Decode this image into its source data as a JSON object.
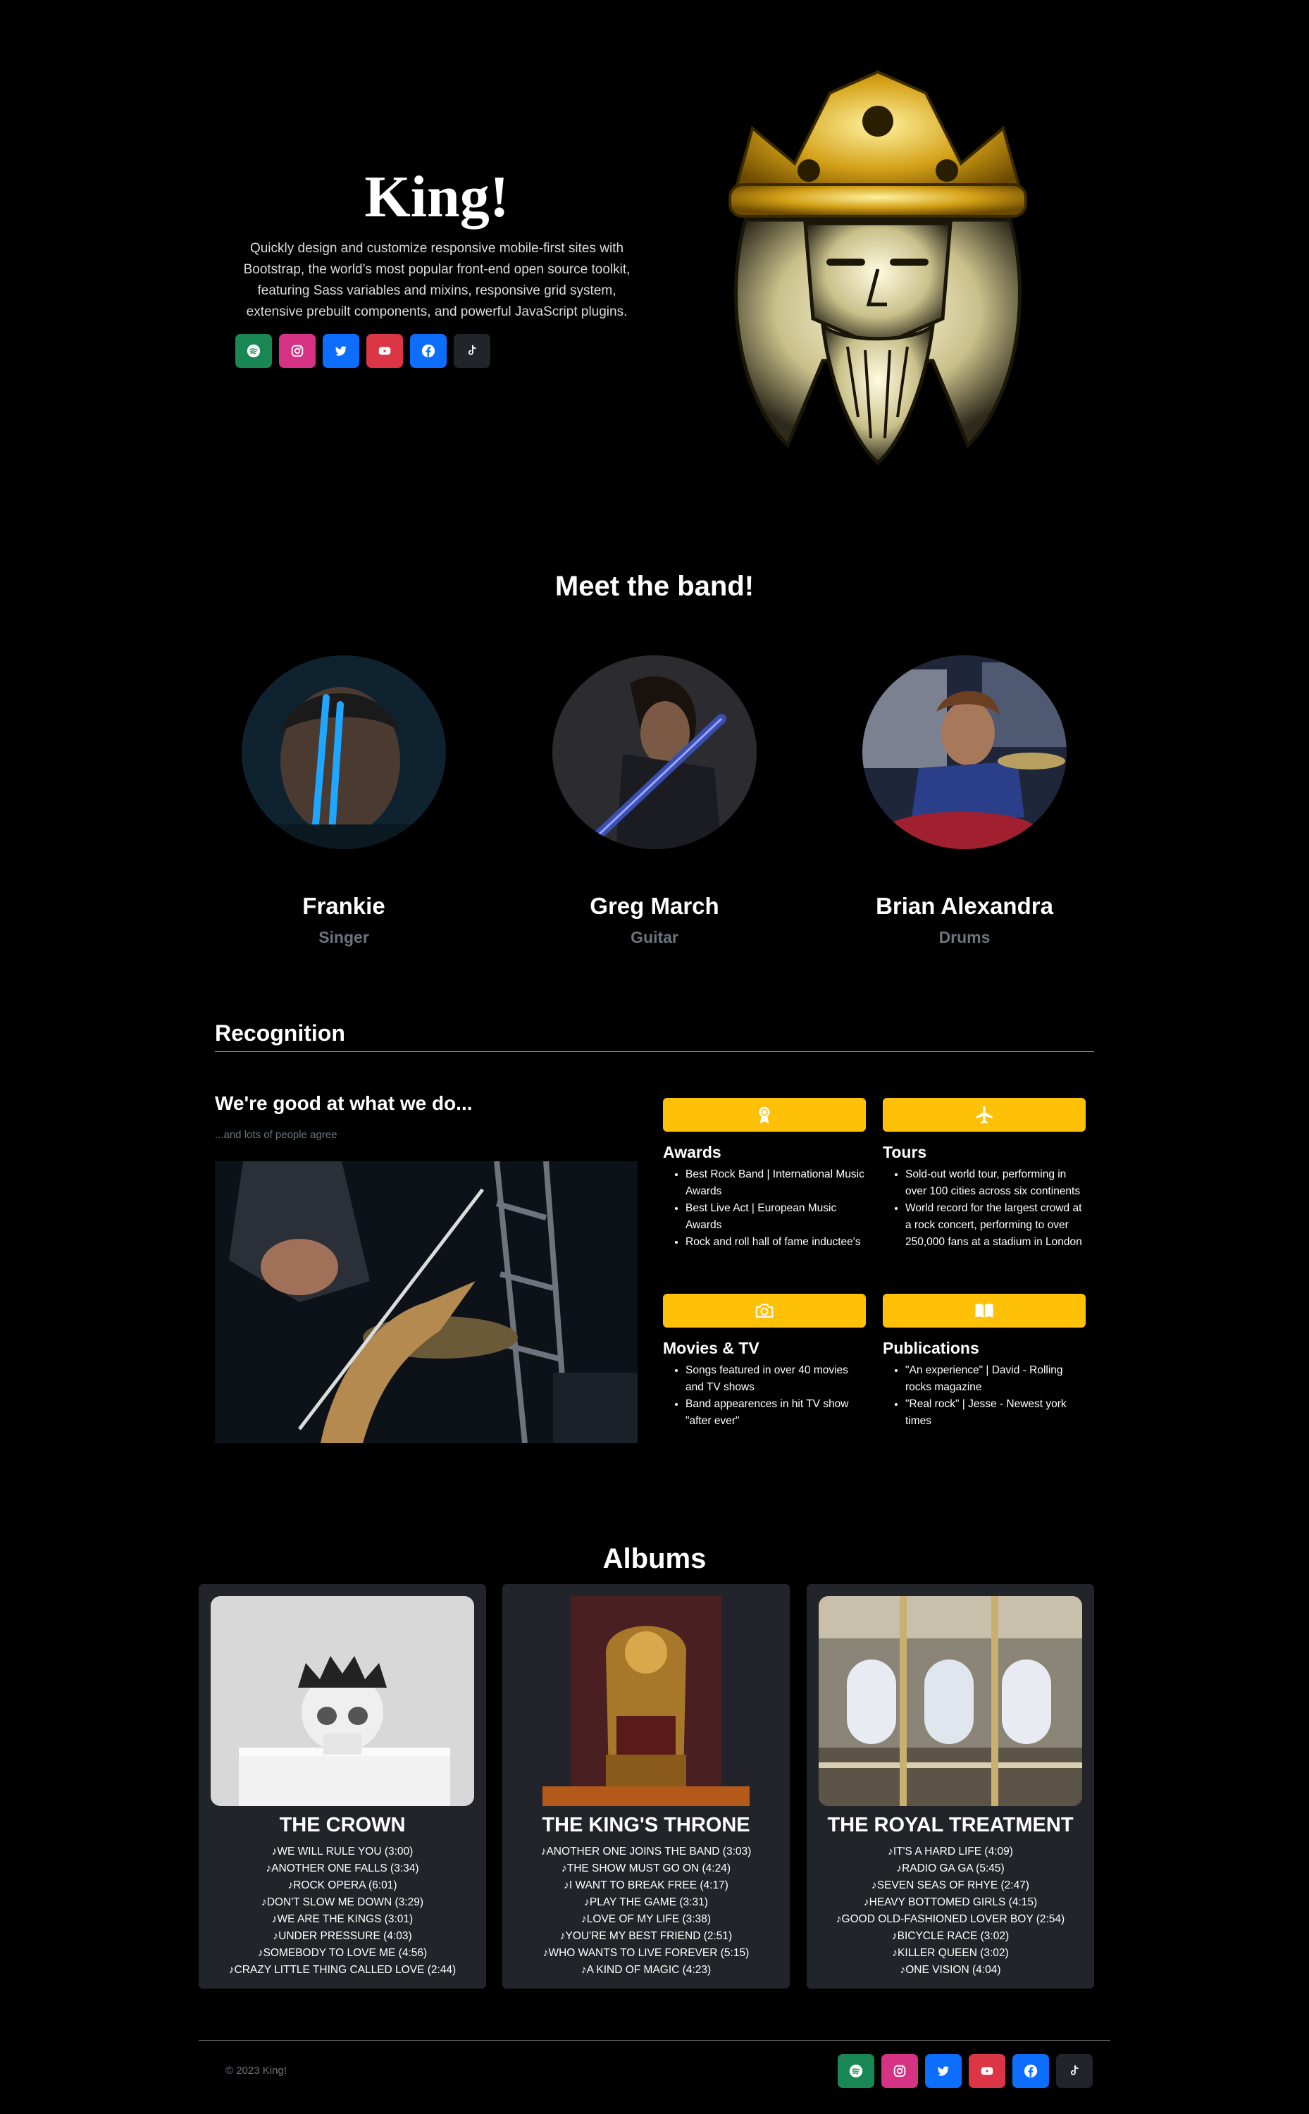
{
  "hero": {
    "title": "King!",
    "description": "Quickly design and customize responsive mobile-first sites with Bootstrap, the world’s most popular front-end open source toolkit, featuring Sass variables and mixins, responsive grid system, extensive prebuilt components, and powerful JavaScript plugins.",
    "social_icons": [
      "spotify-icon",
      "instagram-icon",
      "twitter-icon",
      "youtube-icon",
      "facebook-icon",
      "tiktok-icon"
    ]
  },
  "band": {
    "heading": "Meet the band!",
    "members": [
      {
        "name": "Frankie",
        "role": "Singer"
      },
      {
        "name": "Greg March",
        "role": "Guitar"
      },
      {
        "name": "Brian Alexandra",
        "role": "Drums"
      }
    ]
  },
  "recognition": {
    "heading": "Recognition",
    "subheading": "We're good at what we do...",
    "note": "...and lots of people agree",
    "features": [
      {
        "title": "Awards",
        "icon": "award-icon",
        "items": [
          "Best Rock Band | International Music Awards",
          "Best Live Act | European Music Awards",
          "Rock and roll hall of fame inductee's"
        ]
      },
      {
        "title": "Tours",
        "icon": "airplane-icon",
        "items": [
          "Sold-out world tour, performing in over 100 cities across six continents",
          "World record for the largest crowd at a rock concert, performing to over 250,000 fans at a stadium in London"
        ]
      },
      {
        "title": "Movies & TV",
        "icon": "camera-icon",
        "items": [
          "Songs featured in over 40 movies and TV shows",
          "Band appearences in hit TV show \"after ever\""
        ]
      },
      {
        "title": "Publications",
        "icon": "book-icon",
        "items": [
          "\"An experience\" | David - Rolling rocks magazine",
          "\"Real rock\" | Jesse - Newest york times"
        ]
      }
    ]
  },
  "albums": {
    "heading": "Albums",
    "list": [
      {
        "title": "THE CROWN",
        "tracks": [
          "WE WILL RULE YOU (3:00)",
          "ANOTHER ONE FALLS (3:34)",
          "ROCK OPERA (6:01)",
          "DON'T SLOW ME DOWN (3:29)",
          "WE ARE THE KINGS (3:01)",
          "UNDER PRESSURE (4:03)",
          "SOMEBODY TO LOVE ME (4:56)",
          "CRAZY LITTLE THING CALLED LOVE (2:44)"
        ]
      },
      {
        "title": "THE KING'S THRONE",
        "tracks": [
          "ANOTHER ONE JOINS THE BAND (3:03)",
          "THE SHOW MUST GO ON (4:24)",
          "I WANT TO BREAK FREE (4:17)",
          "PLAY THE GAME (3:31)",
          "LOVE OF MY LIFE (3:38)",
          "YOU'RE MY BEST FRIEND (2:51)",
          "WHO WANTS TO LIVE FOREVER (5:15)",
          "A KIND OF MAGIC (4:23)"
        ]
      },
      {
        "title": "THE ROYAL TREATMENT",
        "tracks": [
          "IT'S A HARD LIFE (4:09)",
          "RADIO GA GA (5:45)",
          "SEVEN SEAS OF RHYE (2:47)",
          "HEAVY BOTTOMED GIRLS (4:15)",
          "GOOD OLD-FASHIONED LOVER BOY (2:54)",
          "BICYCLE RACE (3:02)",
          "KILLER QUEEN (3:02)",
          "ONE VISION (4:04)"
        ]
      }
    ]
  },
  "footer": {
    "copyright": "© 2023 King!"
  },
  "colors": {
    "spotify": "#198754",
    "instagram": "#d63384",
    "twitter": "#0d6efd",
    "youtube": "#dc3545",
    "facebook": "#0d6efd",
    "tiktok": "#212529",
    "feature_bar": "#ffc107",
    "card_bg": "#212529"
  }
}
